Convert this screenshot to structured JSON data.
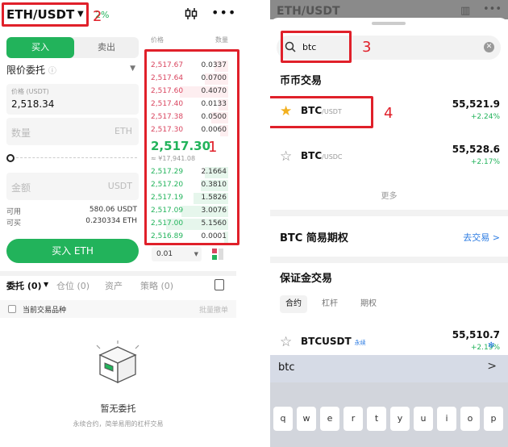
{
  "left": {
    "pair": "ETH/USDT",
    "change": "2%",
    "buy_tab": "买入",
    "sell_tab": "卖出",
    "order_type": "限价委托",
    "price_label": "价格 (USDT)",
    "price_value": "2,518.34",
    "qty_placeholder": "数量",
    "qty_unit": "ETH",
    "amount_placeholder": "金额",
    "amount_unit": "USDT",
    "available_label": "可用",
    "available_value": "580.06 USDT",
    "buyable_label": "可买",
    "buyable_value": "0.230334 ETH",
    "buy_button": "买入 ETH",
    "ob_header_price": "价格",
    "ob_header_qty": "数量",
    "asks": [
      {
        "p": "2,517.67",
        "q": "0.0337",
        "d": 0.18
      },
      {
        "p": "2,517.64",
        "q": "0.0700",
        "d": 0.3
      },
      {
        "p": "2,517.60",
        "q": "0.4070",
        "d": 0.62
      },
      {
        "p": "2,517.40",
        "q": "0.0133",
        "d": 0.12
      },
      {
        "p": "2,517.38",
        "q": "0.0500",
        "d": 0.22
      },
      {
        "p": "2,517.30",
        "q": "0.0060",
        "d": 0.1
      }
    ],
    "mid_price": "2,517.30",
    "mid_fiat": "≈ ¥17,941.08",
    "bids": [
      {
        "p": "2,517.29",
        "q": "2.1664",
        "d": 0.3
      },
      {
        "p": "2,517.20",
        "q": "0.3810",
        "d": 0.35
      },
      {
        "p": "2,517.19",
        "q": "1.5826",
        "d": 0.45
      },
      {
        "p": "2,517.09",
        "q": "3.0076",
        "d": 0.6
      },
      {
        "p": "2,517.00",
        "q": "5.1560",
        "d": 0.8
      },
      {
        "p": "2,516.89",
        "q": "0.0001",
        "d": 0.05
      }
    ],
    "depth": "0.01",
    "tab_orders": "委托 (0)",
    "tab_positions": "仓位 (0)",
    "tab_assets": "资产",
    "tab_strategy": "策略 (0)",
    "current_pair": "当前交易品种",
    "batch_cancel": "批量撤单",
    "empty_title": "暂无委托",
    "empty_sub": "永续合约，简单易用的杠杆交易"
  },
  "right": {
    "header_pair": "ETH/USDT",
    "search_value": "btc",
    "section_spot": "币币交易",
    "spot_items": [
      {
        "name": "BTC",
        "quote": "/USDT",
        "price": "55,521.9",
        "change": "+2.24%",
        "fav": true
      },
      {
        "name": "BTC",
        "quote": "/USDC",
        "price": "55,528.6",
        "change": "+2.17%",
        "fav": false
      }
    ],
    "more": "更多",
    "easy_options": "BTC 简易期权",
    "go_trade": "去交易 >",
    "section_margin": "保证金交易",
    "margin_tabs": [
      "合约",
      "杠杆",
      "期权"
    ],
    "margin_item": {
      "name": "BTCUSDT",
      "tag": "永续",
      "price": "55,510.7",
      "change": "+2.19%"
    },
    "suggestion": "btc",
    "keys": [
      "q",
      "w",
      "e",
      "r",
      "t",
      "y",
      "u",
      "i",
      "o",
      "p"
    ]
  },
  "annotations": {
    "n1": "1",
    "n2": "2",
    "n3": "3",
    "n4": "4"
  },
  "colors": {
    "green": "#22b35b",
    "red": "#d9455f",
    "annotation": "#e0202a"
  }
}
